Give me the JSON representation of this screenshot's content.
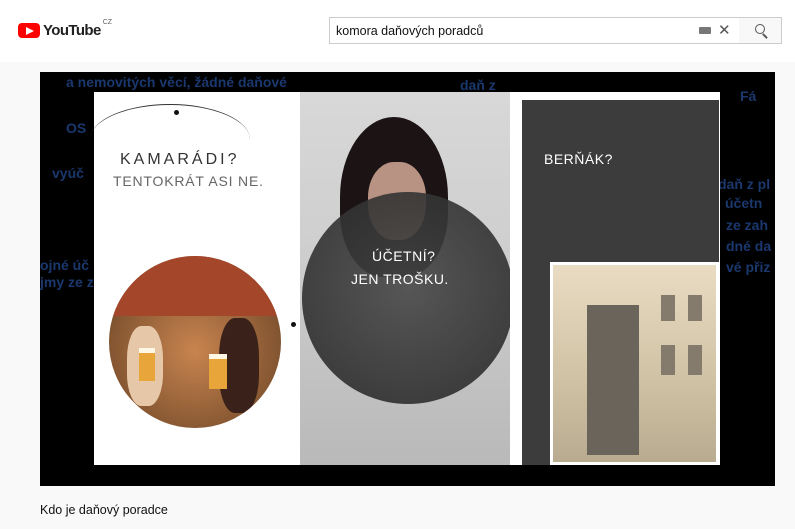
{
  "header": {
    "logo_text": "YouTube",
    "logo_country": "CZ",
    "search_value": "komora daňových poradců"
  },
  "player": {
    "overlay_texts": {
      "kamaradi": "KAMARÁDI?",
      "tentokrat": "TENTOKRÁT ASI NE.",
      "ucetni": "ÚČETNÍ?",
      "jen_trosku": "JEN TROŠKU.",
      "bernak": "BERŇÁK?"
    },
    "background_texts": [
      "a nemovitých věcí, žádné daňové",
      "OS",
      "vyúč",
      "daň z",
      "ojné úč",
      "jmy ze z",
      "daň z pl",
      "účetn",
      "ze zah",
      "dné da",
      "vé přiz",
      "Fá"
    ]
  },
  "video": {
    "title": "Kdo je daňový poradce"
  },
  "colors": {
    "brand_red": "#ff0000",
    "player_bg": "#000000",
    "bg_text_blue": "#1e3f7a"
  }
}
